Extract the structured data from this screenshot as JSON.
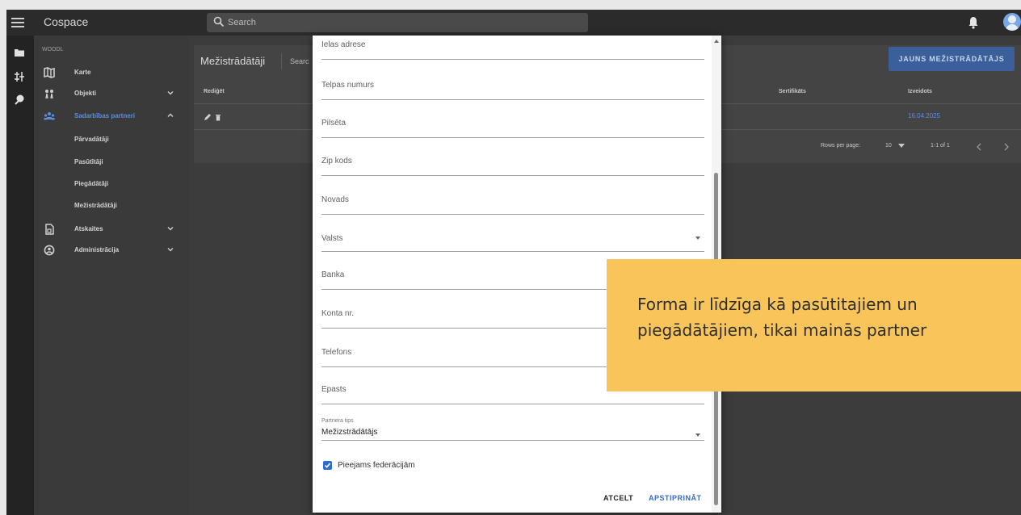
{
  "app": {
    "title": "Cospace",
    "search_placeholder": "Search"
  },
  "rail": {
    "icons": [
      "folder-icon",
      "tree-icon",
      "map-pin-icon"
    ]
  },
  "sidebar": {
    "org": "WOODL",
    "items": [
      {
        "label": "Karte",
        "icon": "map-icon"
      },
      {
        "label": "Objekti",
        "icon": "objects-icon",
        "expandable": true
      },
      {
        "label": "Sadarbības partneri",
        "icon": "partners-icon",
        "expandable": true,
        "active": true
      },
      {
        "label": "Atskaites",
        "icon": "reports-icon",
        "expandable": true
      },
      {
        "label": "Administrācija",
        "icon": "admin-icon",
        "expandable": true
      }
    ],
    "subitems": [
      "Pārvadātāji",
      "Pasūtītāji",
      "Piegādātāji",
      "Mežistrādātāji"
    ]
  },
  "page": {
    "title": "Mežistrādātāji",
    "search_label": "Searc",
    "new_button": "JAUNS MEŽISTRĀDĀTĀJS",
    "columns": {
      "edit": "Rediģēt",
      "certificate": "Sertifikāts",
      "created": "Izveidots"
    },
    "row": {
      "created": "16.04.2025"
    },
    "pager": {
      "rows_per_page_label": "Rows per page:",
      "rows_per_page": "10",
      "range": "1-1 of 1"
    }
  },
  "modal": {
    "fields": [
      "Ielas adrese",
      "Telpas numurs",
      "Pilsēta",
      "Zip kods",
      "Novads",
      "Valsts",
      "Banka",
      "Konta nr.",
      "Telefons",
      "Epasts"
    ],
    "partner_type": {
      "label": "Partnera tips",
      "value": "Mežizstrādātājs"
    },
    "checkbox": {
      "label": "Pieejams federācijām",
      "checked": true
    },
    "cancel_label": "ATCELT",
    "confirm_label": "APSTIPRINĀT"
  },
  "callout": {
    "line1": "Forma ir līdzīga kā pasūtitajiem un",
    "line2": "piegādātājiem, tikai mainās partner"
  },
  "colors": {
    "accent": "#2f6cd1",
    "callout": "#f9c55a",
    "appbar": "#2b2b2b"
  }
}
